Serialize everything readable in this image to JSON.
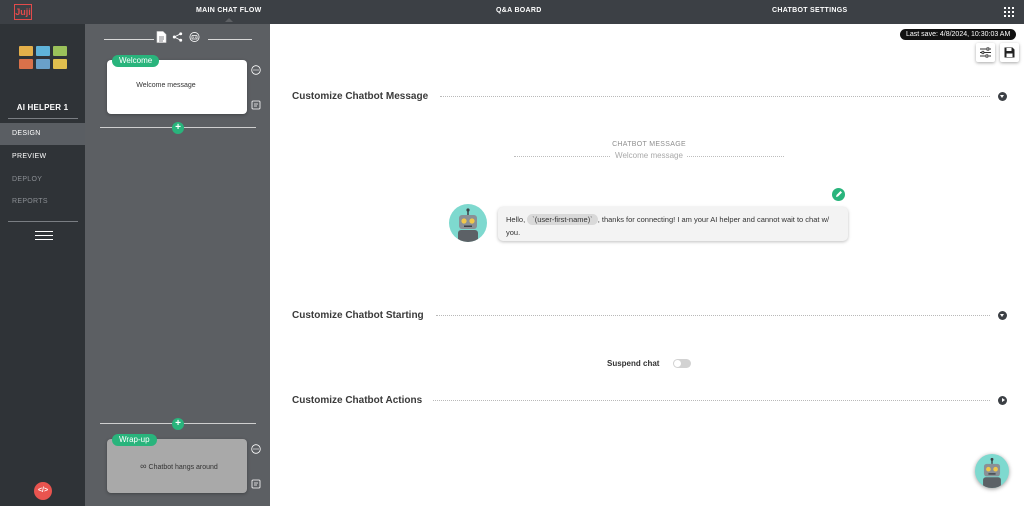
{
  "header": {
    "logo_text": "Juji",
    "tabs": [
      {
        "label": "MAIN CHAT FLOW",
        "active": true
      },
      {
        "label": "Q&A BOARD",
        "active": false
      },
      {
        "label": "CHATBOT SETTINGS",
        "active": false
      }
    ],
    "apps_icon": "grid-icon"
  },
  "sidebar": {
    "assistant_name": "AI HELPER 1",
    "menu": [
      {
        "label": "DESIGN",
        "state": "active"
      },
      {
        "label": "PREVIEW",
        "state": "enabled"
      },
      {
        "label": "DEPLOY",
        "state": "disabled"
      },
      {
        "label": "REPORTS",
        "state": "disabled"
      }
    ],
    "menu_icon": "hamburger-icon",
    "code_button_label": "</>"
  },
  "flow": {
    "toolbar_icons": [
      "document-icon",
      "share-icon",
      "robot-icon"
    ],
    "nodes": [
      {
        "tag": "Welcome",
        "text": "Welcome message"
      },
      {
        "tag": "Wrap-up",
        "text": "Chatbot hangs around"
      }
    ],
    "add_label": "+"
  },
  "editor": {
    "save_status": "Last save: 4/8/2024, 10:30:03 AM",
    "sections": [
      {
        "title": "Customize Chatbot Message",
        "expanded": true
      },
      {
        "title": "Customize Chatbot Starting",
        "expanded": true
      },
      {
        "title": "Customize Chatbot Actions",
        "expanded": false
      }
    ],
    "message": {
      "label": "CHATBOT MESSAGE",
      "name": "Welcome message",
      "text_before": "Hello, ",
      "variable": "`(user-first-name)`",
      "text_after": ", thanks for connecting! I am your AI helper and cannot wait to chat w/ you."
    },
    "suspend_label": "Suspend chat",
    "suspend_on": false
  },
  "colors": {
    "accent": "#29b47c",
    "topbar": "#3c4045",
    "panel": "#5c5f63",
    "nav": "#2f3337",
    "danger": "#e9544f"
  }
}
